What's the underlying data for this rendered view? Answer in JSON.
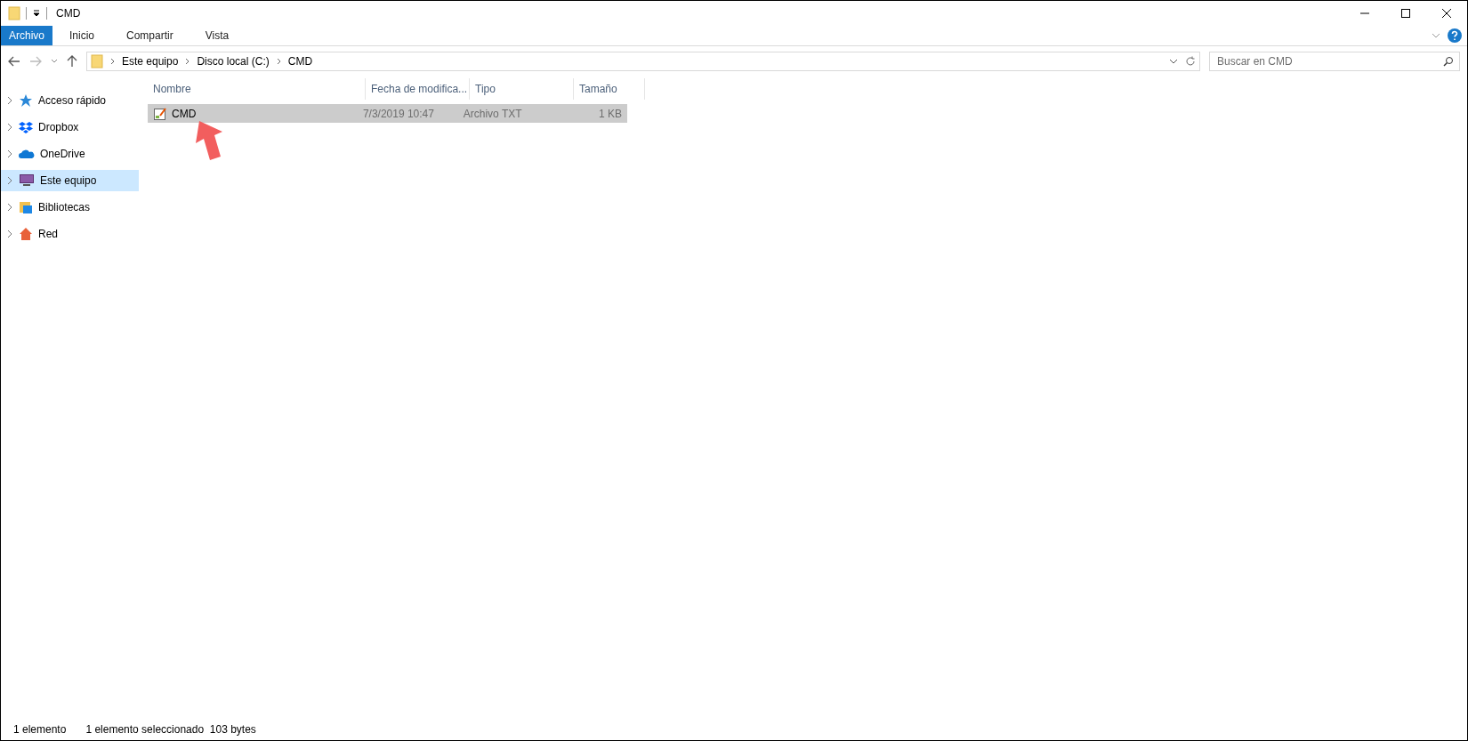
{
  "window": {
    "title": "CMD"
  },
  "ribbon_tabs": [
    {
      "label": "Archivo",
      "selected": true
    },
    {
      "label": "Inicio",
      "selected": false
    },
    {
      "label": "Compartir",
      "selected": false
    },
    {
      "label": "Vista",
      "selected": false
    }
  ],
  "address": {
    "breadcrumb": [
      "Este equipo",
      "Disco local (C:)",
      "CMD"
    ]
  },
  "search": {
    "placeholder": "Buscar en CMD"
  },
  "sidebar": {
    "items": [
      {
        "label": "Acceso rápido",
        "kind": "star",
        "selected": false
      },
      {
        "label": "Dropbox",
        "kind": "dropbox",
        "selected": false
      },
      {
        "label": "OneDrive",
        "kind": "cloud",
        "selected": false
      },
      {
        "label": "Este equipo",
        "kind": "pc",
        "selected": true
      },
      {
        "label": "Bibliotecas",
        "kind": "library",
        "selected": false
      },
      {
        "label": "Red",
        "kind": "network",
        "selected": false
      }
    ]
  },
  "table": {
    "columns": [
      "Nombre",
      "Fecha de modifica...",
      "Tipo",
      "Tamaño"
    ],
    "rows": [
      {
        "cells": [
          "CMD",
          "7/3/2019 10:47",
          "Archivo TXT",
          "1 KB"
        ],
        "selected": true
      }
    ]
  },
  "status_bar": [
    "1 elemento",
    "1 elemento seleccionado  103 bytes"
  ]
}
